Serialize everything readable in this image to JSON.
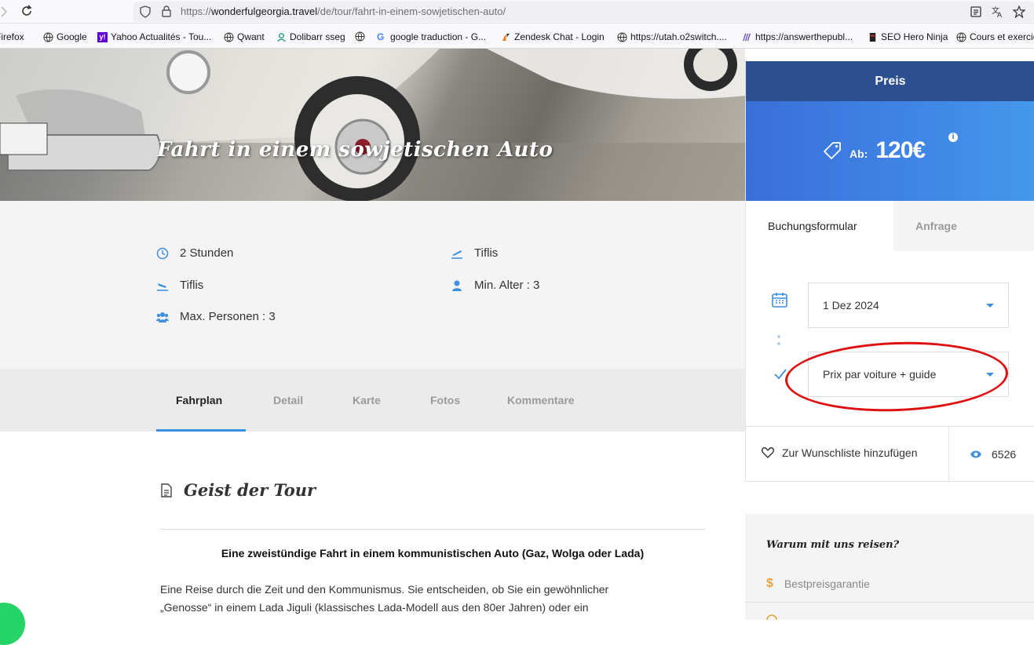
{
  "browser": {
    "url_prefix": "https://",
    "url_host": "wonderfulgeorgia.travel",
    "url_path": "/de/tour/fahrt-in-einem-sowjetischen-auto/",
    "bookmarks": [
      {
        "label": "Firefox",
        "icon": "firefox-icon"
      },
      {
        "label": "Google",
        "icon": "globe-icon"
      },
      {
        "label": "Yahoo Actualités - Tou...",
        "icon": "yahoo-icon"
      },
      {
        "label": "Qwant",
        "icon": "globe-icon"
      },
      {
        "label": "Dolibarr sseg",
        "icon": "dolibarr-icon"
      },
      {
        "label": "",
        "icon": "globe-icon"
      },
      {
        "label": "google traduction - G...",
        "icon": "google-icon"
      },
      {
        "label": "Zendesk Chat - Login",
        "icon": "zendesk-icon"
      },
      {
        "label": "https://utah.o2switch....",
        "icon": "globe-icon"
      },
      {
        "label": "https://answerthepubl...",
        "icon": "answerthepublic-icon"
      },
      {
        "label": "SEO Hero Ninja",
        "icon": "ninja-icon"
      },
      {
        "label": "Cours et exercic",
        "icon": "globe-icon"
      }
    ]
  },
  "hero": {
    "title": "Fahrt in einem sowjetischen Auto"
  },
  "info": {
    "duration": "2 Stunden",
    "departure": "Tiflis",
    "arrival": "Tiflis",
    "min_age": "Min. Alter : 3",
    "max_people": "Max. Personen : 3"
  },
  "tabs": [
    "Fahrplan",
    "Detail",
    "Karte",
    "Fotos",
    "Kommentare"
  ],
  "content": {
    "heading": "Geist der Tour",
    "lead": "Eine zweistündige Fahrt in einem kommunistischen Auto (Gaz, Wolga oder Lada)",
    "para_line1": "Eine Reise durch die Zeit und den Kommunismus. Sie entscheiden, ob Sie ein gewöhnlicher",
    "para_line2": "„Genosse“ in einem Lada Jiguli (klassisches Lada-Modell aus den 80er Jahren) oder ein"
  },
  "sidebar": {
    "price_title": "Preis",
    "price_prefix": "Ab:",
    "price_value": "120€",
    "info_glyph": "i",
    "tab_booking": "Buchungsformular",
    "tab_request": "Anfrage",
    "date_value": "1 Dez 2024",
    "option_value": "Prix par voiture + guide",
    "wishlist": "Zur Wunschliste hinzufügen",
    "views": "6526"
  },
  "why": {
    "title": "Warum mit uns reisen?",
    "item1": "Bestpreisgarantie",
    "item1_glyph": "$"
  },
  "colors": {
    "primary_blue": "#3d8fe0",
    "header_navy": "#2b4f8f",
    "annotation_red": "#dd1111"
  }
}
